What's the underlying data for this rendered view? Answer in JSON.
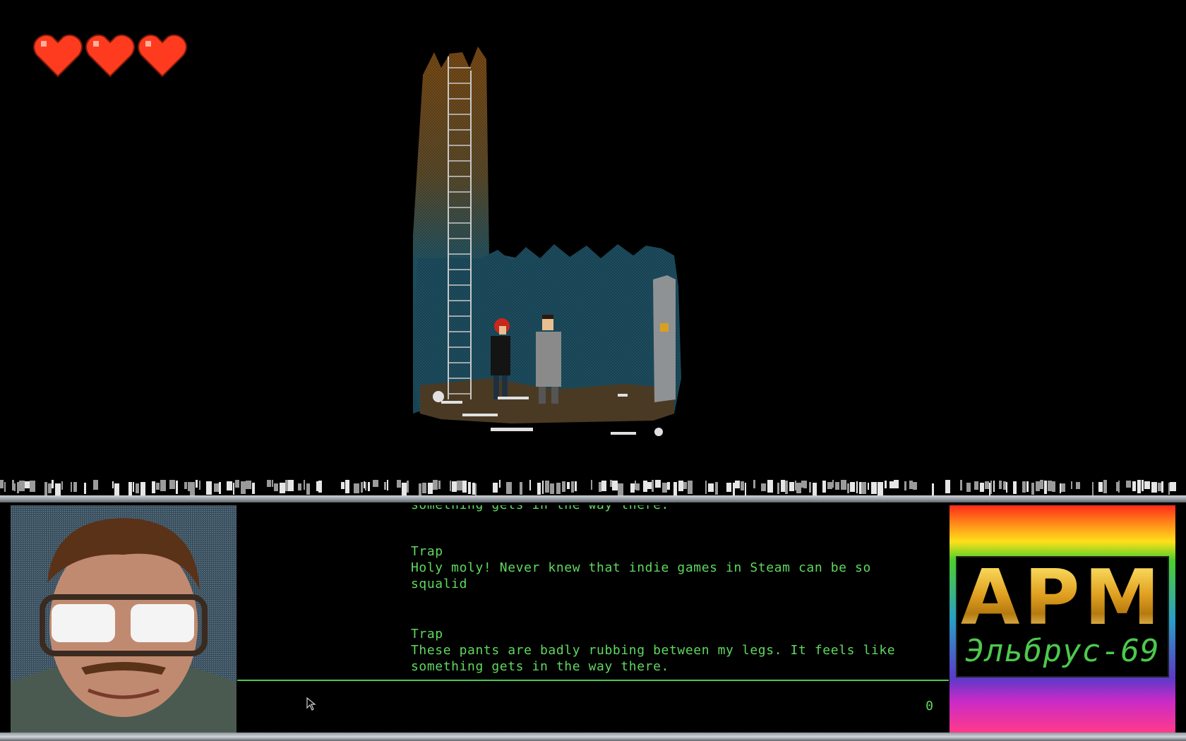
{
  "player": {
    "hearts": 3,
    "max_hearts": 3
  },
  "dialogue": {
    "cut_line": "something gets in the way there.",
    "messages": [
      {
        "speaker": "Trap",
        "lines": [
          "Holy moly! Never knew that indie games in Steam can be so squalid"
        ]
      },
      {
        "speaker": "Trap",
        "lines": [
          "These pants are badly rubbing between my legs. It feels like",
          "something gets in the way there."
        ]
      }
    ]
  },
  "input": {
    "counter": "0"
  },
  "logo": {
    "title": "АРМ",
    "subtitle": "Эльбрус-69"
  },
  "colors": {
    "text": "#5fd85f",
    "heart": "#ff3b1f",
    "background": "#000000",
    "panel_border": "#8e979e"
  }
}
